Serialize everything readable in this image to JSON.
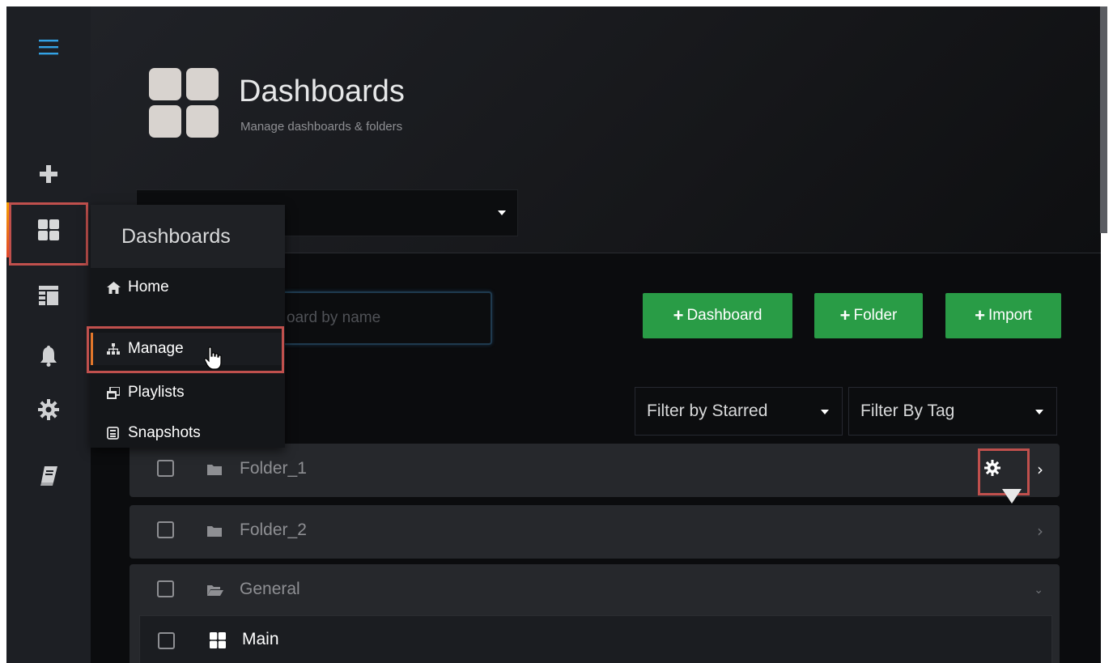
{
  "sidebar": {
    "items": [
      {
        "name": "menu",
        "icon": "hamburger-icon"
      },
      {
        "name": "create",
        "icon": "plus-icon"
      },
      {
        "name": "dashboards",
        "icon": "dashboards-grid-icon",
        "active": true
      },
      {
        "name": "explore",
        "icon": "layout-icon"
      },
      {
        "name": "alerting",
        "icon": "bell-icon"
      },
      {
        "name": "configuration",
        "icon": "gear-icon"
      },
      {
        "name": "docs",
        "icon": "book-icon"
      }
    ]
  },
  "header": {
    "title": "Dashboards",
    "subtitle": "Manage dashboards & folders"
  },
  "dashboards_menu": {
    "title": "Dashboards",
    "items": [
      {
        "label": "Home",
        "icon": "home-icon"
      },
      {
        "label": "Manage",
        "icon": "sitemap-icon",
        "active": true
      },
      {
        "label": "Playlists",
        "icon": "playlist-icon"
      },
      {
        "label": "Snapshots",
        "icon": "snapshot-icon"
      }
    ]
  },
  "search": {
    "placeholder_visible": "oard by name"
  },
  "actions": {
    "dashboard_label": "Dashboard",
    "folder_label": "Folder",
    "import_label": "Import",
    "plus": "+"
  },
  "filters": {
    "starred_label": "Filter by Starred",
    "tag_label": "Filter By Tag"
  },
  "folders": [
    {
      "label": "Folder_1",
      "state": "hover-settings"
    },
    {
      "label": "Folder_2",
      "state": "collapsed"
    },
    {
      "label": "General",
      "state": "expanded"
    }
  ],
  "dashboards": [
    {
      "label": "Main"
    }
  ],
  "colors": {
    "accent_green": "#299c46",
    "highlight_red": "#c0504d",
    "active_orange": "#e2772b"
  }
}
